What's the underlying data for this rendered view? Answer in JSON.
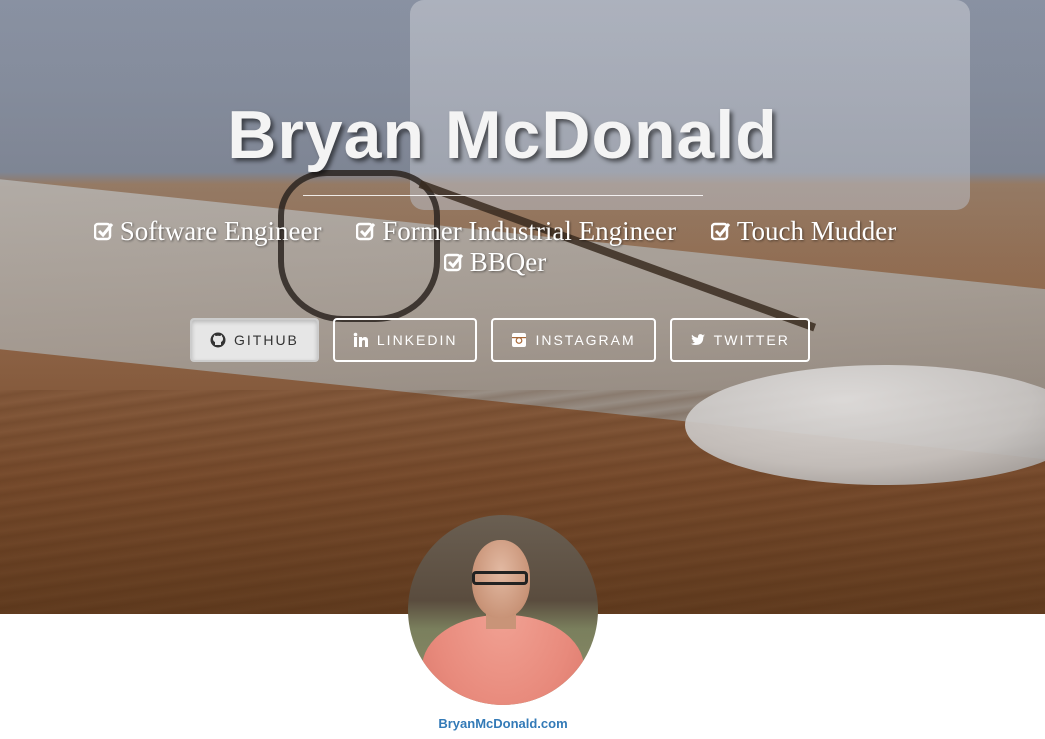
{
  "hero": {
    "name": "Bryan McDonald",
    "traits": [
      {
        "label": "Software Engineer",
        "icon": "check-square-icon"
      },
      {
        "label": "Former Industrial Engineer",
        "icon": "check-square-icon"
      },
      {
        "label": "Touch Mudder",
        "icon": "check-square-icon"
      },
      {
        "label": "BBQer",
        "icon": "check-square-icon"
      }
    ]
  },
  "social": {
    "github": {
      "label": "GitHub",
      "icon": "github-icon"
    },
    "linkedin": {
      "label": "LinkedIn",
      "icon": "linkedin-icon"
    },
    "instagram": {
      "label": "Instagram",
      "icon": "instagram-icon"
    },
    "twitter": {
      "label": "Twitter",
      "icon": "twitter-icon"
    }
  },
  "profile": {
    "site_link": "BryanMcDonald.com"
  },
  "colors": {
    "link": "#337ab7",
    "hero_text": "#ffffff"
  }
}
